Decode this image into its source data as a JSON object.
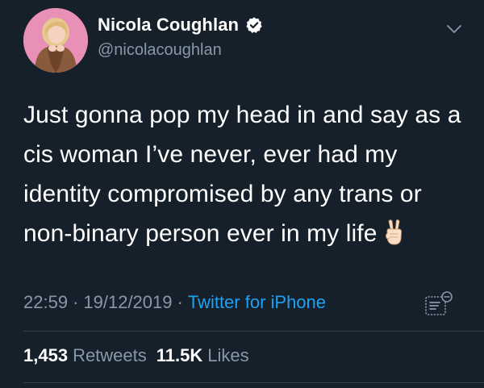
{
  "author": {
    "display_name": "Nicola Coughlan",
    "handle": "@nicolacoughlan",
    "verified": true
  },
  "tweet": {
    "text": "Just gonna pop my head in and say as a cis woman I’ve never, ever had my identity compromised by any trans or non-binary person ever in my life",
    "emoji": "victory-hand"
  },
  "meta": {
    "time": "22:59",
    "separator_1": "·",
    "date": "19/12/2019",
    "separator_2": "·",
    "source": "Twitter for iPhone"
  },
  "stats": {
    "retweets_count": "1,453",
    "retweets_label": "Retweets",
    "likes_count": "11.5K",
    "likes_label": "Likes"
  },
  "icons": {
    "verified": "verified-badge-icon",
    "menu": "chevron-down-icon",
    "analytics": "analytics-icon"
  },
  "colors": {
    "background": "#15202b",
    "text": "#ffffff",
    "secondary": "#8899a6",
    "link": "#1da1f2",
    "divider": "#38444d"
  }
}
